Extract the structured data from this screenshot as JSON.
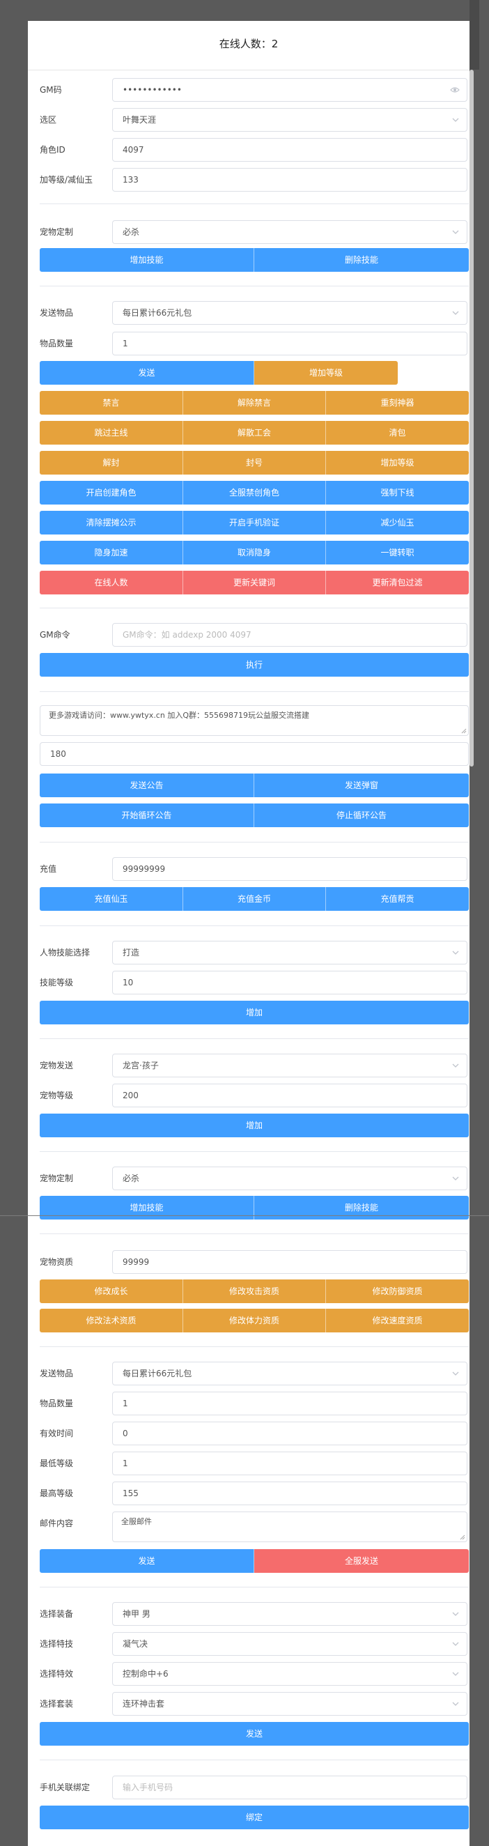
{
  "online": {
    "title": "在线人数：2"
  },
  "gm": {
    "code_label": "GM码",
    "code_value": "••••••••••••",
    "zone_label": "选区",
    "zone_value": "叶舞天涯",
    "role_label": "角色ID",
    "role_value": "4097",
    "level_label": "加等级/减仙玉",
    "level_value": "133"
  },
  "pet_skill": {
    "label": "宠物定制",
    "value": "必杀",
    "add": "增加技能",
    "delete": "删除技能"
  },
  "send_item": {
    "item_label": "发送物品",
    "item_value": "每日累计66元礼包",
    "qty_label": "物品数量",
    "qty_value": "1",
    "send": "发送",
    "add_level": "增加等级"
  },
  "actions": {
    "row1": [
      "禁言",
      "解除禁言",
      "重刻神器"
    ],
    "row2": [
      "跳过主线",
      "解散工会",
      "清包"
    ],
    "row3": [
      "解封",
      "封号",
      "增加等级"
    ],
    "row4": [
      "开启创建角色",
      "全服禁创角色",
      "强制下线"
    ],
    "row5": [
      "清除摆摊公示",
      "开启手机验证",
      "减少仙玉"
    ],
    "row6": [
      "隐身加速",
      "取消隐身",
      "一键转职"
    ],
    "row7": [
      "在线人数",
      "更新关键词",
      "更新清包过滤"
    ]
  },
  "gm_command": {
    "label": "GM命令",
    "placeholder": "GM命令：如 addexp 2000 4097",
    "exec": "执行"
  },
  "notice": {
    "text": "更多游戏请访问：www.ywtyx.cn  加入Q群：555698719玩公益服交流搭建",
    "interval": "180",
    "send_notice": "发送公告",
    "send_popup": "发送弹窗",
    "start_loop": "开始循环公告",
    "stop_loop": "停止循环公告"
  },
  "recharge": {
    "label": "充值",
    "value": "99999999",
    "jade": "充值仙玉",
    "gold": "充值金币",
    "guild": "充值帮贡"
  },
  "char_skill": {
    "select_label": "人物技能选择",
    "select_value": "打造",
    "level_label": "技能等级",
    "level_value": "10",
    "add": "增加"
  },
  "pet_send": {
    "label": "宠物发送",
    "value": "龙宫·孩子",
    "level_label": "宠物等级",
    "level_value": "200",
    "add": "增加"
  },
  "pet_skill2": {
    "label": "宠物定制",
    "value": "必杀",
    "add": "增加技能",
    "delete": "删除技能"
  },
  "pet_aptitude": {
    "label": "宠物资质",
    "value": "99999",
    "row1": [
      "修改成长",
      "修改攻击资质",
      "修改防御资质"
    ],
    "row2": [
      "修改法术资质",
      "修改体力资质",
      "修改速度资质"
    ]
  },
  "mail": {
    "item_label": "发送物品",
    "item_value": "每日累计66元礼包",
    "qty_label": "物品数量",
    "qty_value": "1",
    "valid_label": "有效时间",
    "valid_value": "0",
    "min_label": "最低等级",
    "min_value": "1",
    "max_label": "最高等级",
    "max_value": "155",
    "content_label": "邮件内容",
    "content_value": "全服邮件",
    "send": "发送",
    "send_all": "全服发送"
  },
  "equip": {
    "equip_label": "选择装备",
    "equip_value": "神甲 男",
    "skill_label": "选择特技",
    "skill_value": "凝气决",
    "effect_label": "选择特效",
    "effect_value": "控制命中+6",
    "set_label": "选择套装",
    "set_value": "连环神击套",
    "send": "发送"
  },
  "phone": {
    "label": "手机关联绑定",
    "placeholder": "输入手机号码",
    "bind": "绑定"
  },
  "colors": {
    "blue": "#409eff",
    "orange": "#e6a23c",
    "red": "#f56c6c"
  },
  "icons": {
    "select": "chevron-down-icon",
    "password": "eye-icon"
  }
}
